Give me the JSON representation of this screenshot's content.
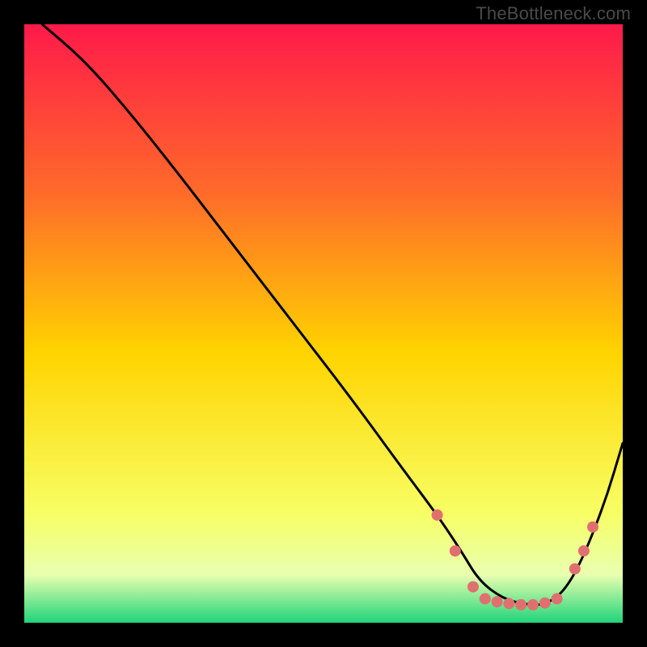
{
  "attribution": "TheBottleneck.com",
  "chart_data": {
    "type": "line",
    "title": "",
    "xlabel": "",
    "ylabel": "",
    "xlim": [
      0,
      100
    ],
    "ylim": [
      0,
      100
    ],
    "grid": false,
    "legend": false,
    "gradient_colors": {
      "top": "#ff1a4a",
      "upper_mid": "#ff6a2a",
      "mid": "#ffd400",
      "lower_mid": "#f7ff66",
      "bottom": "#20d47a"
    },
    "series": [
      {
        "name": "curve",
        "color": "#000000",
        "x": [
          3,
          10,
          17,
          25,
          35,
          45,
          55,
          63,
          69,
          73,
          76,
          80,
          84,
          87,
          90,
          93,
          97,
          100
        ],
        "y": [
          100,
          94,
          86,
          76,
          63,
          50,
          37,
          26,
          18,
          12,
          7,
          4,
          3,
          3,
          5,
          10,
          20,
          30
        ]
      }
    ],
    "markers": {
      "name": "dots",
      "color": "#e07070",
      "radius": 7,
      "points": [
        {
          "x": 69,
          "y": 18
        },
        {
          "x": 72,
          "y": 12
        },
        {
          "x": 75,
          "y": 6
        },
        {
          "x": 77,
          "y": 4
        },
        {
          "x": 79,
          "y": 3.5
        },
        {
          "x": 81,
          "y": 3.2
        },
        {
          "x": 83,
          "y": 3
        },
        {
          "x": 85,
          "y": 3
        },
        {
          "x": 87,
          "y": 3.3
        },
        {
          "x": 89,
          "y": 4
        },
        {
          "x": 92,
          "y": 9
        },
        {
          "x": 93.5,
          "y": 12
        },
        {
          "x": 95,
          "y": 16
        }
      ]
    }
  }
}
